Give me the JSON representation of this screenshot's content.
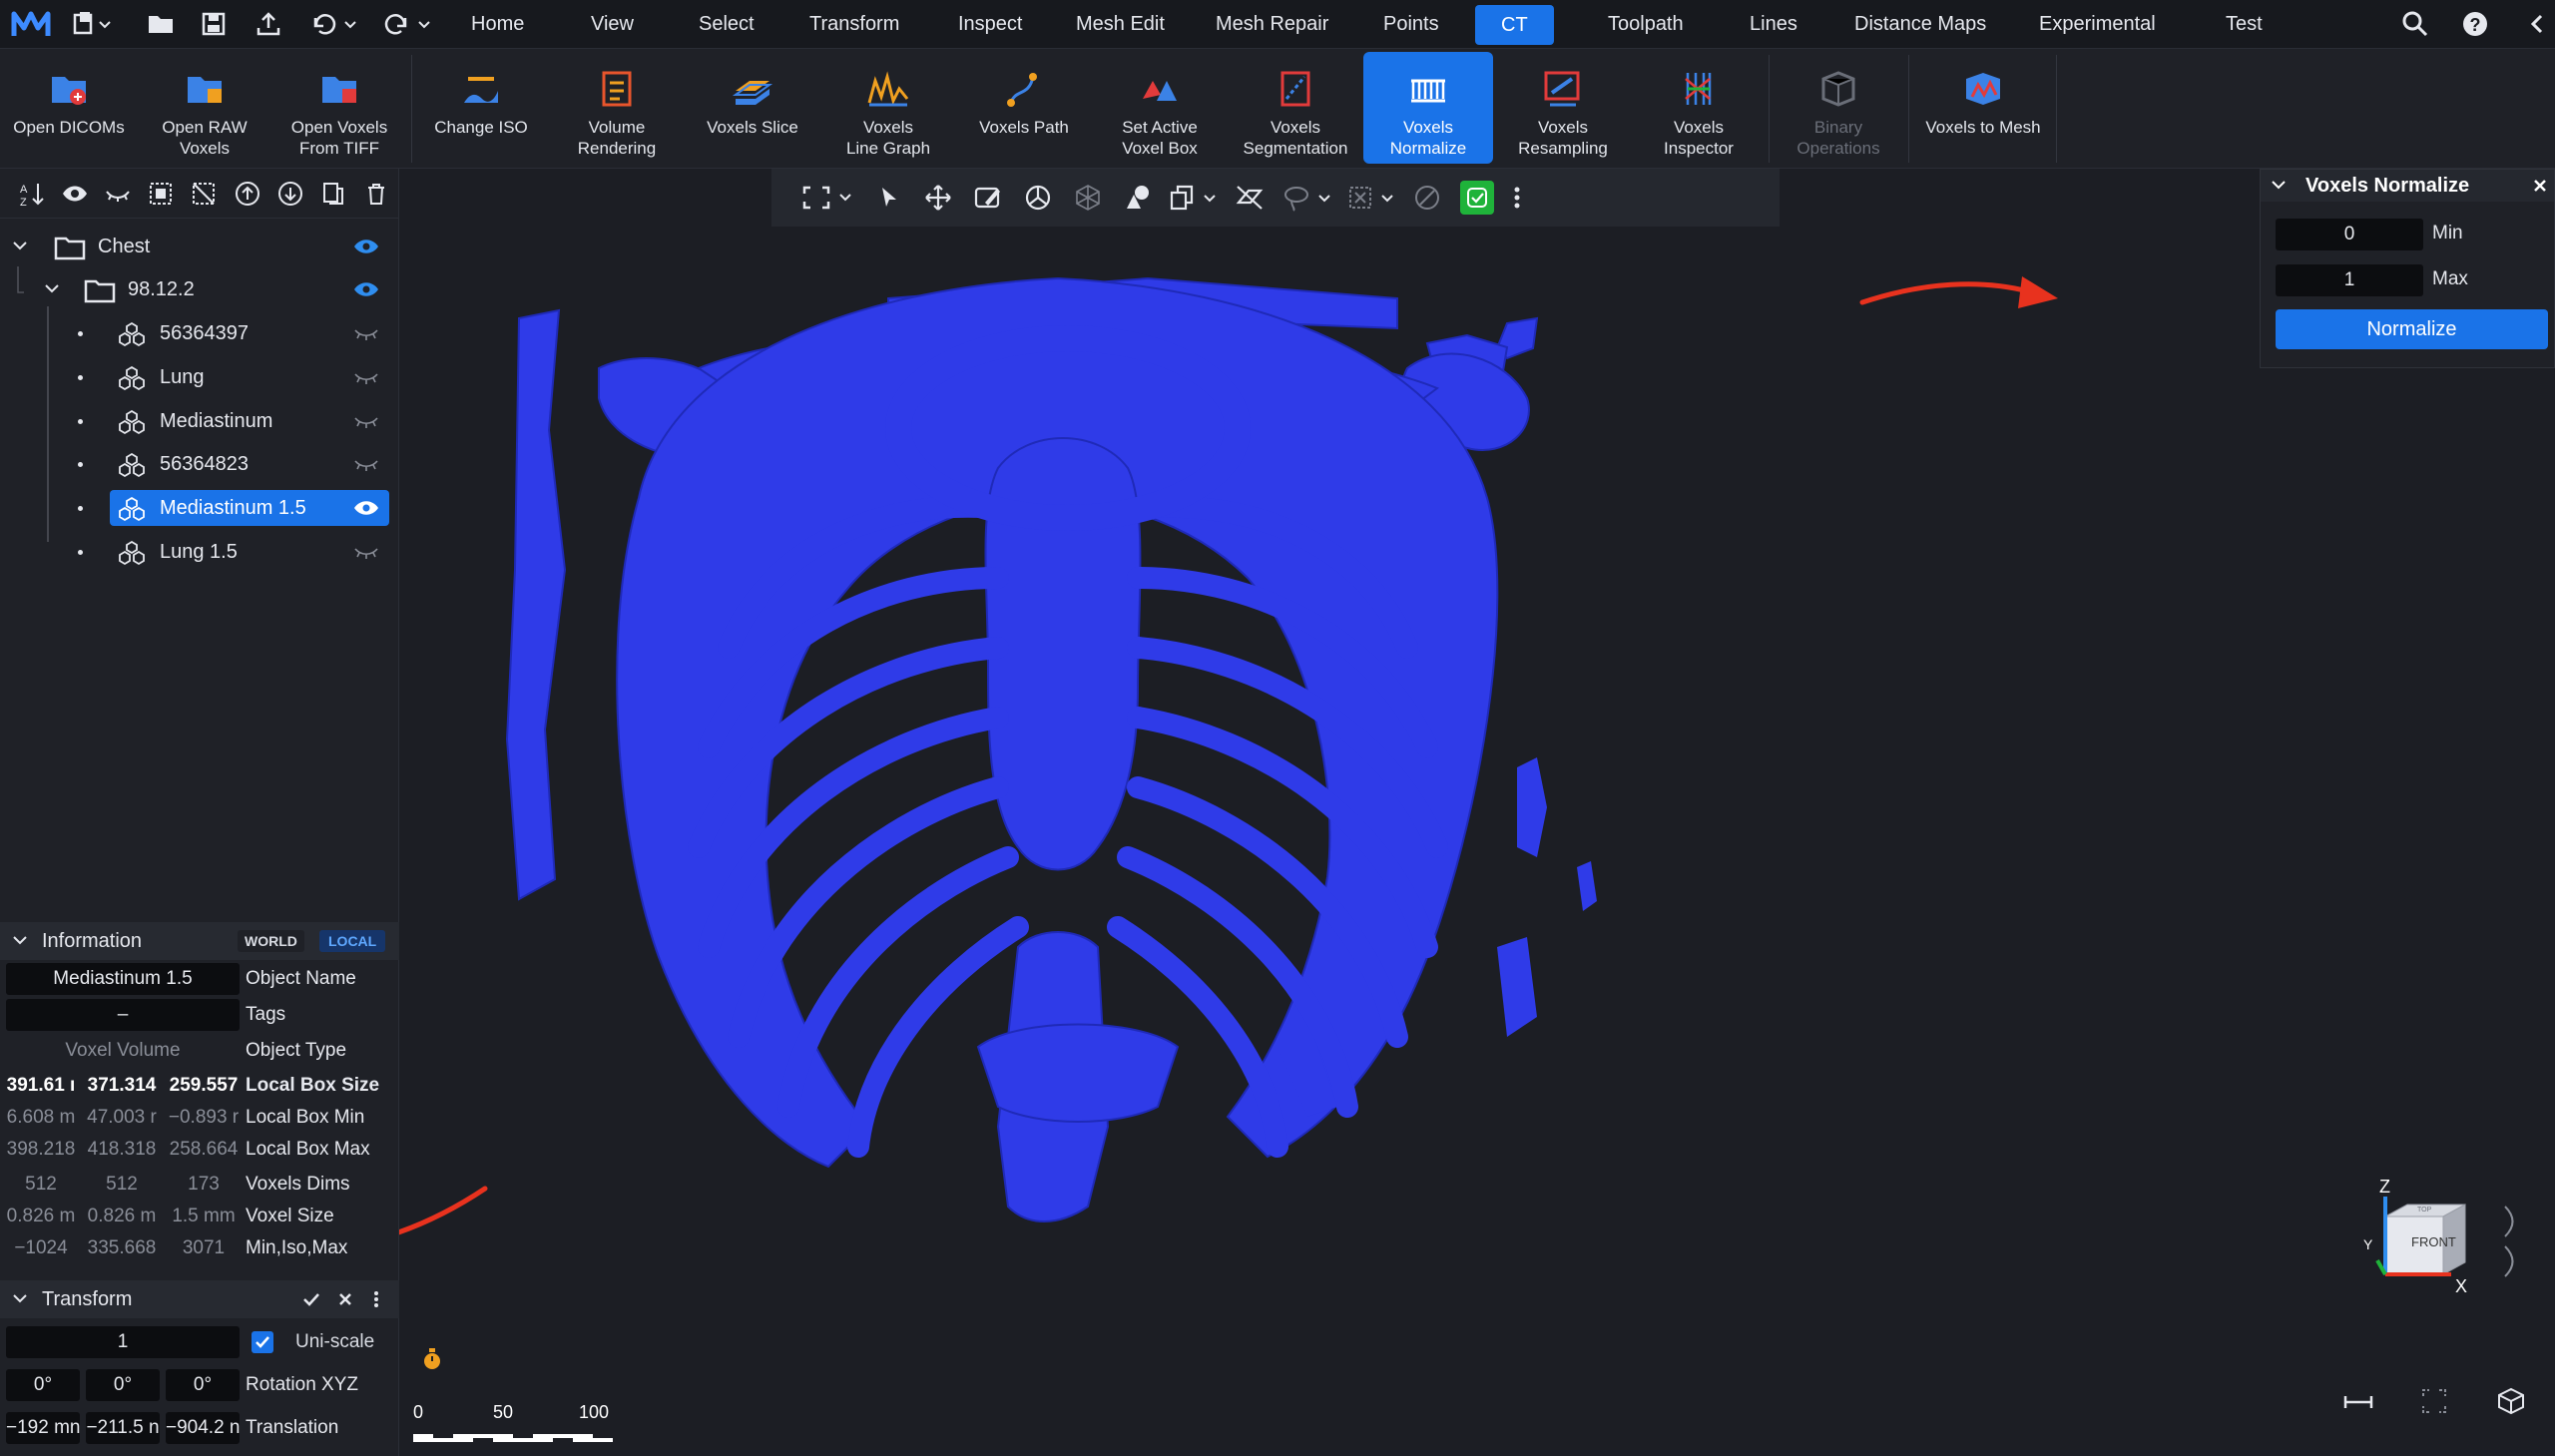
{
  "menu": {
    "items": [
      "Home",
      "View",
      "Select",
      "Transform",
      "Inspect",
      "Mesh Edit",
      "Mesh Repair",
      "Points",
      "CT",
      "Toolpath",
      "Lines",
      "Distance Maps",
      "Experimental",
      "Test"
    ],
    "active": "CT"
  },
  "ribbon": {
    "buttons": [
      {
        "line1": "Open DICOMs",
        "line2": ""
      },
      {
        "line1": "Open RAW",
        "line2": "Voxels"
      },
      {
        "line1": "Open Voxels",
        "line2": "From TIFF"
      },
      {
        "line1": "Change ISO",
        "line2": ""
      },
      {
        "line1": "Volume",
        "line2": "Rendering"
      },
      {
        "line1": "Voxels Slice",
        "line2": ""
      },
      {
        "line1": "Voxels",
        "line2": "Line Graph"
      },
      {
        "line1": "Voxels Path",
        "line2": ""
      },
      {
        "line1": "Set Active",
        "line2": "Voxel Box"
      },
      {
        "line1": "Voxels",
        "line2": "Segmentation"
      },
      {
        "line1": "Voxels",
        "line2": "Normalize"
      },
      {
        "line1": "Voxels",
        "line2": "Resampling"
      },
      {
        "line1": "Voxels",
        "line2": "Inspector"
      },
      {
        "line1": "Binary",
        "line2": "Operations"
      },
      {
        "line1": "Voxels to Mesh",
        "line2": ""
      }
    ]
  },
  "tree": {
    "root": "Chest",
    "folder": "98.12.2",
    "items": [
      "56364397",
      "Lung",
      "Mediastinum",
      "56364823",
      "Mediastinum 1.5",
      "Lung 1.5"
    ],
    "selected": "Mediastinum 1.5"
  },
  "information": {
    "title": "Information",
    "world": "WORLD",
    "local": "LOCAL",
    "object_name": "Mediastinum 1.5",
    "object_name_label": "Object Name",
    "tags": "–",
    "tags_label": "Tags",
    "object_type": "Voxel Volume",
    "object_type_label": "Object Type",
    "rows": [
      {
        "label": "Local Box Size",
        "v": [
          "391.61 ı",
          "371.314",
          "259.557"
        ]
      },
      {
        "label": "Local Box Min",
        "v": [
          "6.608 m",
          "47.003 r",
          "−0.893 r"
        ]
      },
      {
        "label": "Local Box Max",
        "v": [
          "398.218",
          "418.318",
          "258.664"
        ]
      },
      {
        "label": "Voxels Dims",
        "v": [
          "512",
          "512",
          "173"
        ]
      },
      {
        "label": "Voxel Size",
        "v": [
          "0.826 m",
          "0.826 m",
          "1.5 mm"
        ]
      },
      {
        "label": "Min,Iso,Max",
        "v": [
          "−1024",
          "335.668",
          "3071"
        ]
      }
    ]
  },
  "transform": {
    "title": "Transform",
    "scale": "1",
    "uniscale_label": "Uni-scale",
    "rotation": [
      "0°",
      "0°",
      "0°"
    ],
    "rotation_label": "Rotation XYZ",
    "translation": [
      "−192 mn",
      "−211.5 n",
      "−904.2 n"
    ],
    "translation_label": "Translation"
  },
  "normalize_panel": {
    "title": "Voxels Normalize",
    "min_value": "0",
    "min_label": "Min",
    "max_value": "1",
    "max_label": "Max",
    "button": "Normalize"
  },
  "scale_bar": {
    "ticks": [
      "0",
      "50",
      "100"
    ]
  },
  "view_cube": {
    "face": "FRONT",
    "top_face": "TOP",
    "axis_z": "Z",
    "axis_y": "Y",
    "axis_x": "X"
  },
  "colors": {
    "accent": "#1a73e8",
    "mesh": "#2f3be8",
    "arrow": "#e8321e",
    "green": "#1fb33a"
  }
}
